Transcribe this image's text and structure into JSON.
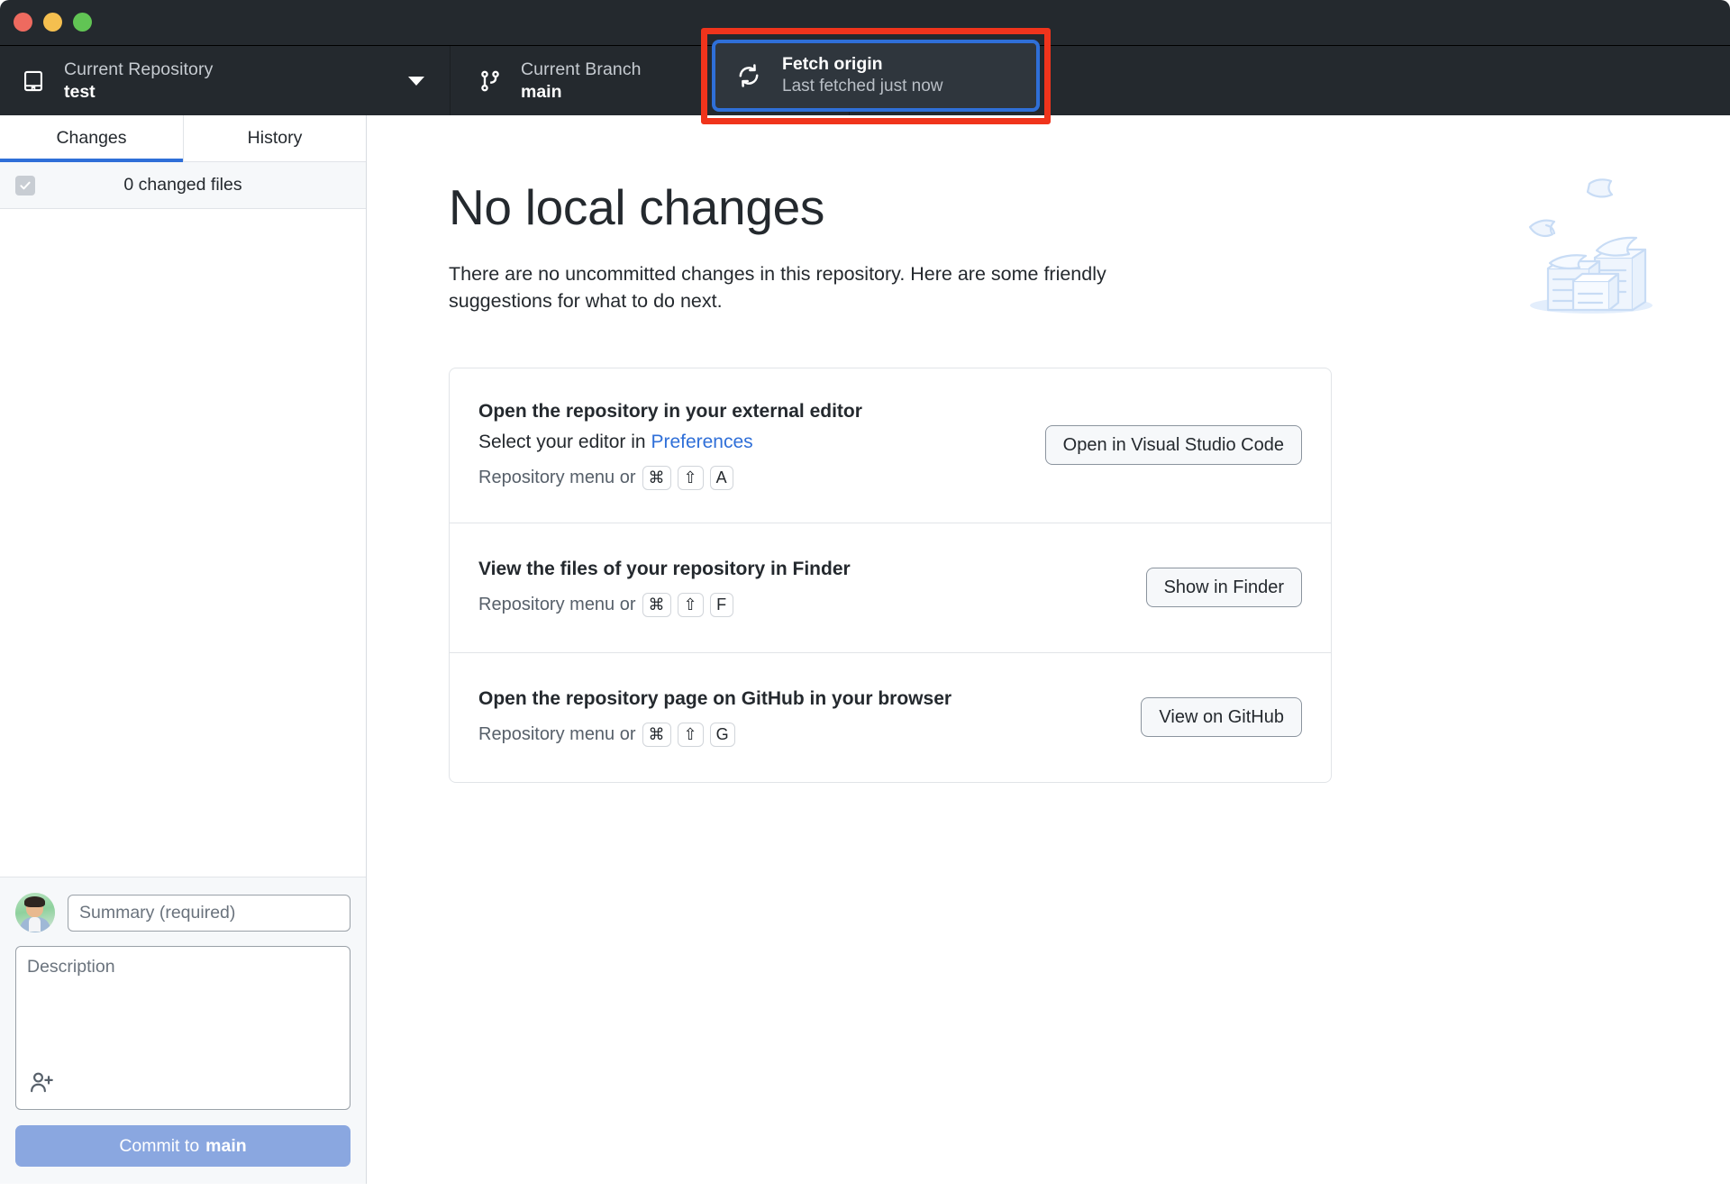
{
  "window": {
    "traffic_lights": [
      "close",
      "minimize",
      "maximize"
    ],
    "colors": {
      "titlebar_bg": "#24292e",
      "accent_blue": "#2f6fd8",
      "highlight_red": "#f0341c",
      "sidebar_bg": "#f6f8fa",
      "commit_button_bg": "#8aa7e0"
    }
  },
  "toolbar": {
    "repository": {
      "label": "Current Repository",
      "value": "test",
      "icon": "repo-icon",
      "caret": "chevron-down-icon"
    },
    "branch": {
      "label": "Current Branch",
      "value": "main",
      "icon": "git-branch-icon",
      "caret": "chevron-down-icon"
    },
    "fetch": {
      "title": "Fetch origin",
      "subtitle": "Last fetched just now",
      "icon": "sync-icon",
      "highlighted": true
    }
  },
  "sidebar": {
    "tabs": [
      {
        "label": "Changes",
        "active": true
      },
      {
        "label": "History",
        "active": false
      }
    ],
    "files_header": {
      "checkbox_state": "checked-disabled",
      "count_label": "0 changed files"
    },
    "commit_form": {
      "avatar": "user-avatar",
      "summary_placeholder": "Summary (required)",
      "summary_value": "",
      "description_placeholder": "Description",
      "description_value": "",
      "coauthor_icon": "add-person-icon",
      "commit_button_prefix": "Commit to ",
      "commit_button_branch": "main"
    }
  },
  "main": {
    "title": "No local changes",
    "description": "There are no uncommitted changes in this repository. Here are some friendly suggestions for what to do next.",
    "illustration": "paper-stack-illustration",
    "suggestions": [
      {
        "title": "Open the repository in your external editor",
        "subtitle_prefix": "Select your editor in ",
        "subtitle_link": "Preferences",
        "shortcut_prefix": "Repository menu or",
        "keys": [
          "⌘",
          "⇧",
          "A"
        ],
        "button": "Open in Visual Studio Code"
      },
      {
        "title": "View the files of your repository in Finder",
        "subtitle_prefix": "",
        "subtitle_link": "",
        "shortcut_prefix": "Repository menu or",
        "keys": [
          "⌘",
          "⇧",
          "F"
        ],
        "button": "Show in Finder"
      },
      {
        "title": "Open the repository page on GitHub in your browser",
        "subtitle_prefix": "",
        "subtitle_link": "",
        "shortcut_prefix": "Repository menu or",
        "keys": [
          "⌘",
          "⇧",
          "G"
        ],
        "button": "View on GitHub"
      }
    ]
  }
}
